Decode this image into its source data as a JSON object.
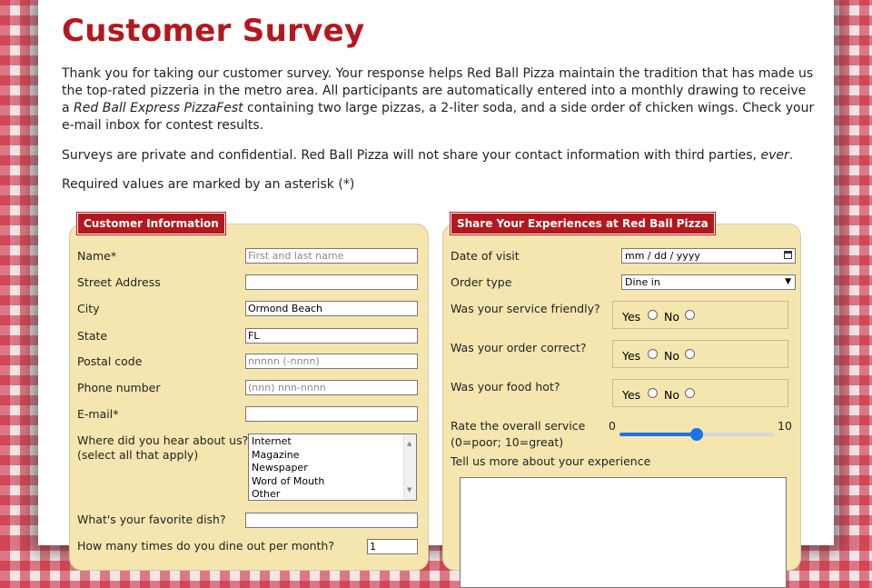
{
  "title": "Customer Survey",
  "intro": {
    "p1_a": "Thank you for taking our customer survey. Your response helps Red Ball Pizza maintain the tradition that has made us the top-rated pizzeria in the metro area. All participants are automatically entered into a monthly drawing to receive a ",
    "p1_em": "Red Ball Express PizzaFest",
    "p1_b": " containing two large pizzas, a 2-liter soda, and a side order of chicken wings. Check your e-mail inbox for contest results.",
    "p2_a": "Surveys are private and confidential. Red Ball Pizza will not share your contact information with third parties, ",
    "p2_em": "ever",
    "p2_b": ".",
    "p3": "Required values are marked by an asterisk (*)"
  },
  "customer": {
    "legend": "Customer Information",
    "name_label": "Name*",
    "name_placeholder": "First and last name",
    "street_label": "Street Address",
    "city_label": "City",
    "city_value": "Ormond Beach",
    "state_label": "State",
    "state_value": "FL",
    "postal_label": "Postal code",
    "postal_placeholder": "nnnnn (-nnnn)",
    "phone_label": "Phone number",
    "phone_placeholder": "(nnn) nnn-nnnn",
    "email_label": "E-mail*",
    "heard_label_1": "Where did you hear about us?",
    "heard_label_2": "(select all that apply)",
    "heard_options": [
      "Internet",
      "Magazine",
      "Newspaper",
      "Word of Mouth",
      "Other"
    ],
    "dish_label": "What's your favorite dish?",
    "dineout_label": "How many times do you dine out per month?",
    "dineout_value": "1"
  },
  "experience": {
    "legend": "Share Your Experiences at Red Ball Pizza",
    "date_label": "Date of visit",
    "date_value": "mm / dd / yyyy",
    "order_label": "Order type",
    "order_value": "Dine in",
    "friendly_label": "Was your service friendly?",
    "correct_label": "Was your order correct?",
    "hot_label": "Was your food hot?",
    "yes": "Yes",
    "no": "No",
    "rate_label_1": "Rate the overall service",
    "rate_label_2": "(0=poor; 10=great)",
    "rate_min": "0",
    "rate_max": "10",
    "rate_value": 5,
    "tell_label": "Tell us more about your experience"
  },
  "colors": {
    "accent": "#b2181d",
    "panel": "#f5e6b0",
    "slider": "#1a73e8"
  }
}
